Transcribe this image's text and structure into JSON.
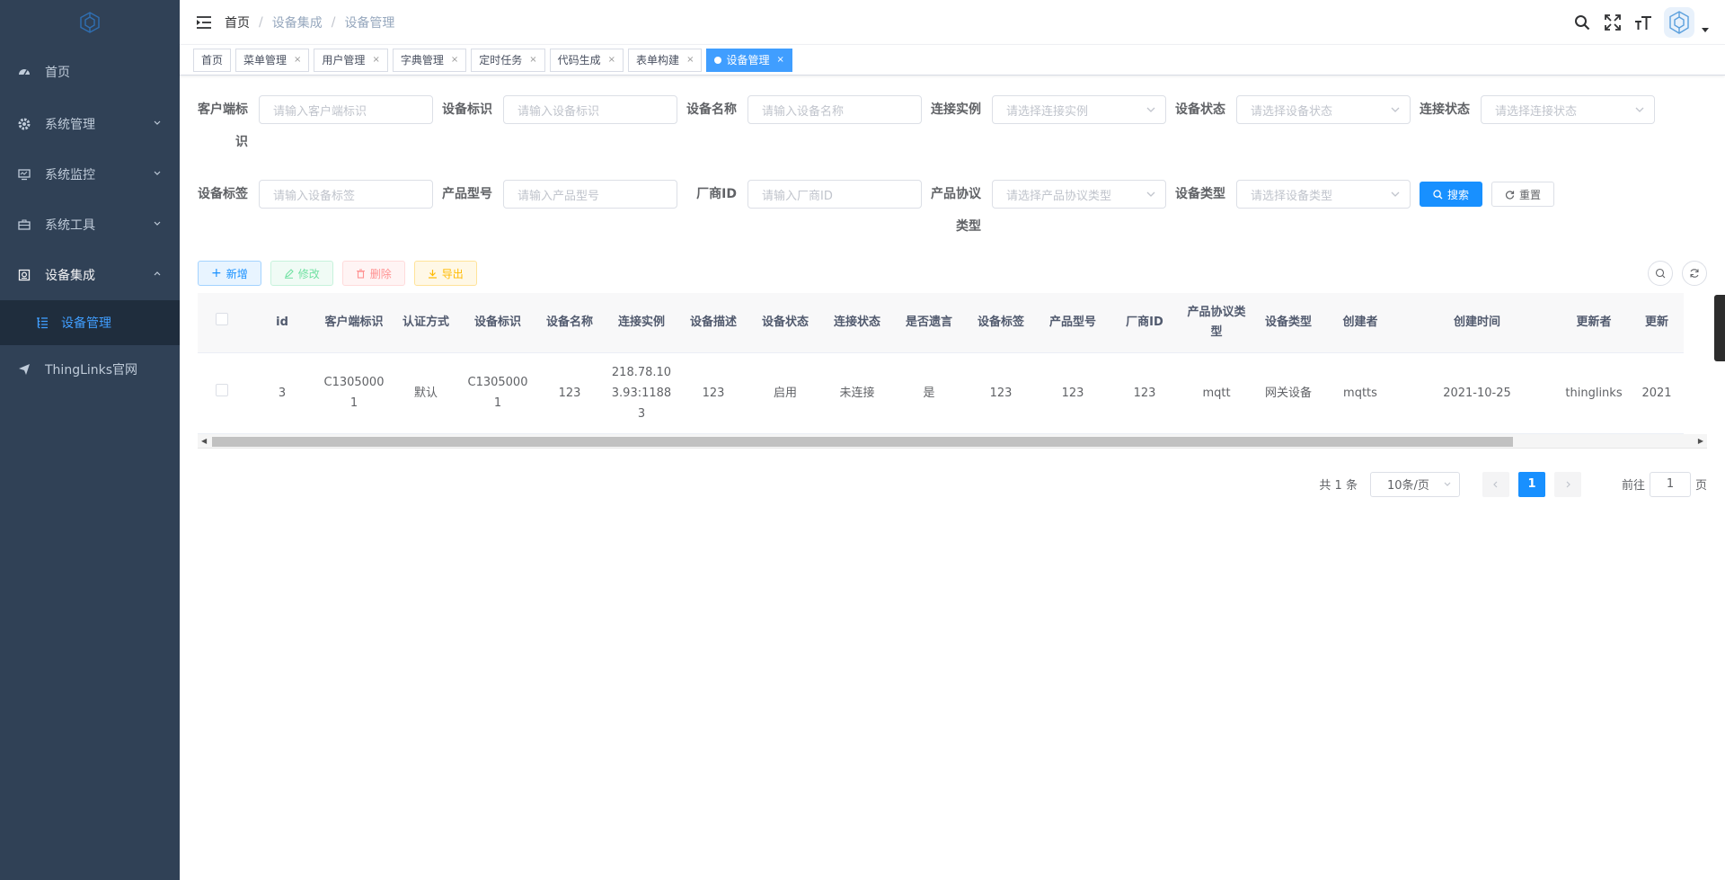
{
  "sidebar": {
    "items": [
      {
        "label": "首页",
        "icon": "dashboard-icon",
        "has_chevron": false
      },
      {
        "label": "系统管理",
        "icon": "gear-icon",
        "has_chevron": true
      },
      {
        "label": "系统监控",
        "icon": "monitor-icon",
        "has_chevron": true
      },
      {
        "label": "系统工具",
        "icon": "toolbox-icon",
        "has_chevron": true
      },
      {
        "label": "设备集成",
        "icon": "device-icon",
        "has_chevron": true,
        "expanded": true
      },
      {
        "label": "ThingLinks官网",
        "icon": "send-icon",
        "has_chevron": false
      }
    ],
    "submenu": {
      "label": "设备管理",
      "icon": "tree-list-icon"
    }
  },
  "breadcrumb": [
    "首页",
    "设备集成",
    "设备管理"
  ],
  "tags": [
    {
      "label": "首页",
      "closable": false
    },
    {
      "label": "菜单管理",
      "closable": true
    },
    {
      "label": "用户管理",
      "closable": true
    },
    {
      "label": "字典管理",
      "closable": true
    },
    {
      "label": "定时任务",
      "closable": true
    },
    {
      "label": "代码生成",
      "closable": true
    },
    {
      "label": "表单构建",
      "closable": true
    },
    {
      "label": "设备管理",
      "closable": true,
      "active": true
    }
  ],
  "search": {
    "row1": [
      {
        "label": "客户端标识",
        "placeholder": "请输入客户端标识",
        "type": "input"
      },
      {
        "label": "设备标识",
        "placeholder": "请输入设备标识",
        "type": "input"
      },
      {
        "label": "设备名称",
        "placeholder": "请输入设备名称",
        "type": "input"
      },
      {
        "label": "连接实例",
        "placeholder": "请选择连接实例",
        "type": "select"
      },
      {
        "label": "设备状态",
        "placeholder": "请选择设备状态",
        "type": "select"
      },
      {
        "label": "连接状态",
        "placeholder": "请选择连接状态",
        "type": "select"
      }
    ],
    "row2": [
      {
        "label": "设备标签",
        "placeholder": "请输入设备标签",
        "type": "input"
      },
      {
        "label": "产品型号",
        "placeholder": "请输入产品型号",
        "type": "input"
      },
      {
        "label": "厂商ID",
        "placeholder": "请输入厂商ID",
        "type": "input"
      },
      {
        "label": "产品协议类型",
        "placeholder": "请选择产品协议类型",
        "type": "select"
      },
      {
        "label": "设备类型",
        "placeholder": "请选择设备类型",
        "type": "select"
      }
    ],
    "search_label": "搜索",
    "reset_label": "重置"
  },
  "toolbar": {
    "add_label": "新增",
    "edit_label": "修改",
    "delete_label": "删除",
    "export_label": "导出"
  },
  "table": {
    "columns": [
      "id",
      "客户端标识",
      "认证方式",
      "设备标识",
      "设备名称",
      "连接实例",
      "设备描述",
      "设备状态",
      "连接状态",
      "是否遗言",
      "设备标签",
      "产品型号",
      "厂商ID",
      "产品协议类型",
      "设备类型",
      "创建者",
      "创建时间",
      "更新者",
      "更新"
    ],
    "rows": [
      [
        "3",
        "C13050001",
        "默认",
        "C13050001",
        "123",
        "218.78.103.93:11883",
        "123",
        "启用",
        "未连接",
        "是",
        "123",
        "123",
        "123",
        "mqtt",
        "网关设备",
        "mqtts",
        "2021-10-25",
        "thinglinks",
        "2021"
      ]
    ]
  },
  "pagination": {
    "total": "共 1 条",
    "page_size": "10条/页",
    "current_page": "1",
    "jump_prefix": "前往",
    "jump_value": "1",
    "jump_suffix": "页"
  },
  "colors": {
    "sidebar_bg": "#304156",
    "submenu_bg": "#1f2d3d",
    "primary": "#1890ff",
    "active_tag": "#409eff"
  }
}
